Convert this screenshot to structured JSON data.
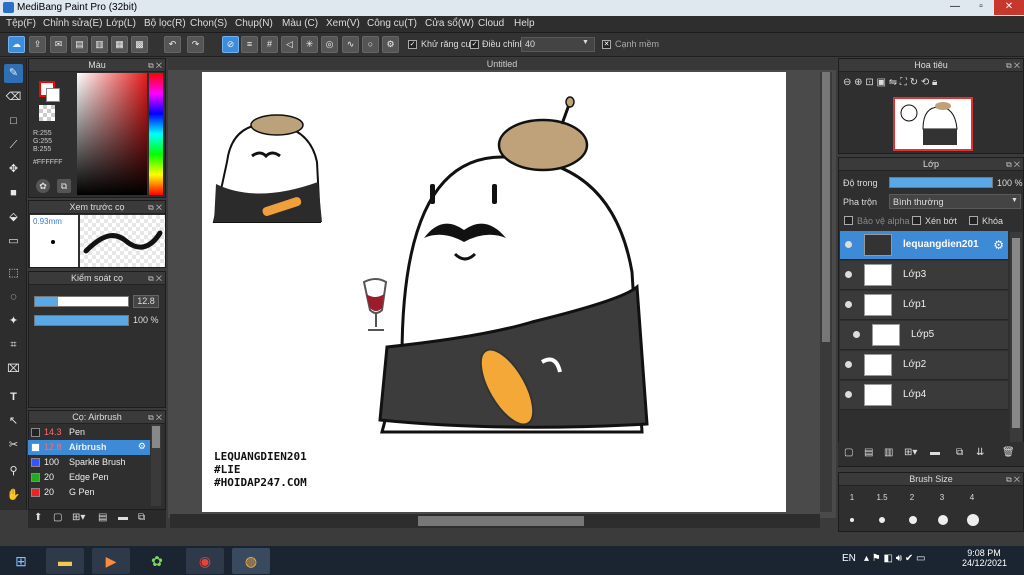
{
  "window": {
    "title": "MediBang Paint Pro (32bit)"
  },
  "menu": [
    "Tệp(F)",
    "Chỉnh sửa(E)",
    "Lớp(L)",
    "Bộ lọc(R)",
    "Chọn(S)",
    "Chụp(N)",
    "Màu (C)",
    "Xem(V)",
    "Công cụ(T)",
    "Cửa sổ(W)",
    "Cloud",
    "Help"
  ],
  "toolbar": {
    "antialias_label": "Khử răng cưa",
    "adjust_label": "Điều chỉnh",
    "adjust_value": "40",
    "sharp_edge_label": "Cạnh mềm"
  },
  "color_panel": {
    "title": "Màu",
    "r": "R:255",
    "g": "G:255",
    "b": "B:255",
    "hex": "#FFFFFF",
    "primary": "#ff0000",
    "secondary": "#ffffff"
  },
  "brush_preview": {
    "title": "Xem trước cọ",
    "size": "0.93mm"
  },
  "brush_control": {
    "title": "Kiểm soát cọ",
    "size_value": "12.8",
    "opacity_value": "100 %",
    "opacity_fraction": 1.0
  },
  "brush_list": {
    "title": "Cọ: Airbrush",
    "items": [
      {
        "size": "14.3",
        "name": "Pen",
        "color": "#222222"
      },
      {
        "size": "12.8",
        "name": "Airbrush",
        "color": "#ffffff"
      },
      {
        "size": "100",
        "name": "Sparkle Brush",
        "color": "#3355ff"
      },
      {
        "size": "20",
        "name": "Edge Pen",
        "color": "#22aa22"
      },
      {
        "size": "20",
        "name": "G Pen",
        "color": "#ee2222"
      }
    ]
  },
  "document": {
    "tab": "Untitled"
  },
  "canvas_text": {
    "line1": "LEQUANGDIEN201",
    "line2": "#LIE",
    "line3": "#HOIDAP247.COM"
  },
  "navigator": {
    "title": "Hoa tiêu"
  },
  "layer_panel": {
    "title": "Lớp",
    "opacity_label": "Độ trong",
    "opacity_value": "100 %",
    "opacity_fraction": 1.0,
    "blend_label": "Pha trộn",
    "blend_value": "Bình thường",
    "protect_alpha": "Bảo vệ alpha",
    "clipping": "Xén bớt",
    "lock": "Khóa",
    "layers": [
      {
        "name": "lequangdien201",
        "selected": true
      },
      {
        "name": "Lớp3",
        "selected": false
      },
      {
        "name": "Lớp1",
        "selected": false
      },
      {
        "name": "Lớp5",
        "selected": false
      },
      {
        "name": "Lớp2",
        "selected": false
      },
      {
        "name": "Lớp4",
        "selected": false
      }
    ]
  },
  "brush_size_panel": {
    "title": "Brush Size",
    "sizes": [
      "1",
      "1.5",
      "2",
      "3",
      "4"
    ]
  },
  "taskbar": {
    "lang": "EN",
    "time": "9:08 PM",
    "date": "24/12/2021"
  }
}
